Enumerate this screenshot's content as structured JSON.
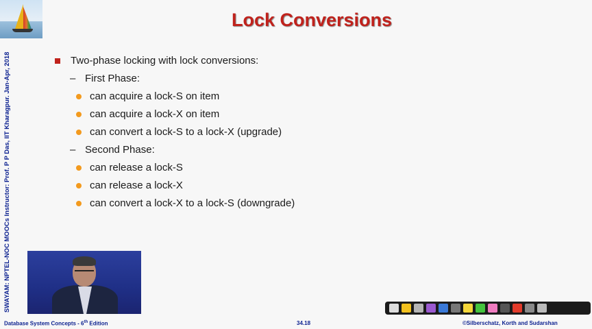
{
  "slide": {
    "title": "Lock Conversions",
    "side_text": "SWAYAM: NPTEL-NOC MOOCs Instructor: Prof. P P Das, IIT Kharagpur. Jan-Apr, 2018",
    "main_bullet": "Two-phase locking with lock conversions:",
    "phase1": {
      "label": "First Phase:",
      "items": [
        "can acquire a lock-S on item",
        "can acquire a lock-X on item",
        "can convert a lock-S to a lock-X (upgrade)"
      ]
    },
    "phase2": {
      "label": "Second Phase:",
      "items": [
        "can release a lock-S",
        "can release a lock-X",
        "can convert a lock-X to a lock-S  (downgrade)"
      ]
    }
  },
  "footer": {
    "left": "Database System Concepts - 6",
    "left_sup": "th",
    "left_tail": " Edition",
    "center": "34.18",
    "right": "©Silberschatz, Korth and Sudarshan"
  },
  "toolbar": {
    "tools": [
      "arrow-icon",
      "highlighter-icon",
      "eraser-icon",
      "pen-purple-icon",
      "pen-blue-icon",
      "keyboard-icon",
      "pen-yellow-icon",
      "pen-green-icon",
      "pen-pink-icon",
      "pointer-icon",
      "laser-icon",
      "screen-icon",
      "close-icon"
    ]
  }
}
